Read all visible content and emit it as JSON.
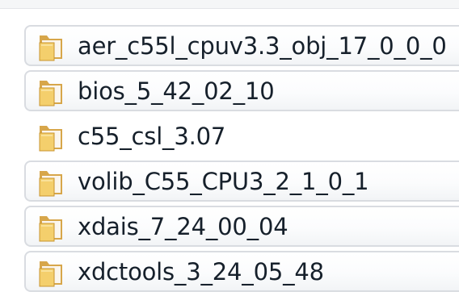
{
  "folders": [
    {
      "name": "aer_c55l_cpuv3.3_obj_17_0_0_0",
      "icon": "folder-icon"
    },
    {
      "name": "bios_5_42_02_10",
      "icon": "folder-icon"
    },
    {
      "name": "c55_csl_3.07",
      "icon": "folder-icon"
    },
    {
      "name": "volib_C55_CPU3_2_1_0_1",
      "icon": "folder-icon"
    },
    {
      "name": "xdais_7_24_00_04",
      "icon": "folder-icon"
    },
    {
      "name": "xdctools_3_24_05_48",
      "icon": "folder-icon"
    }
  ]
}
